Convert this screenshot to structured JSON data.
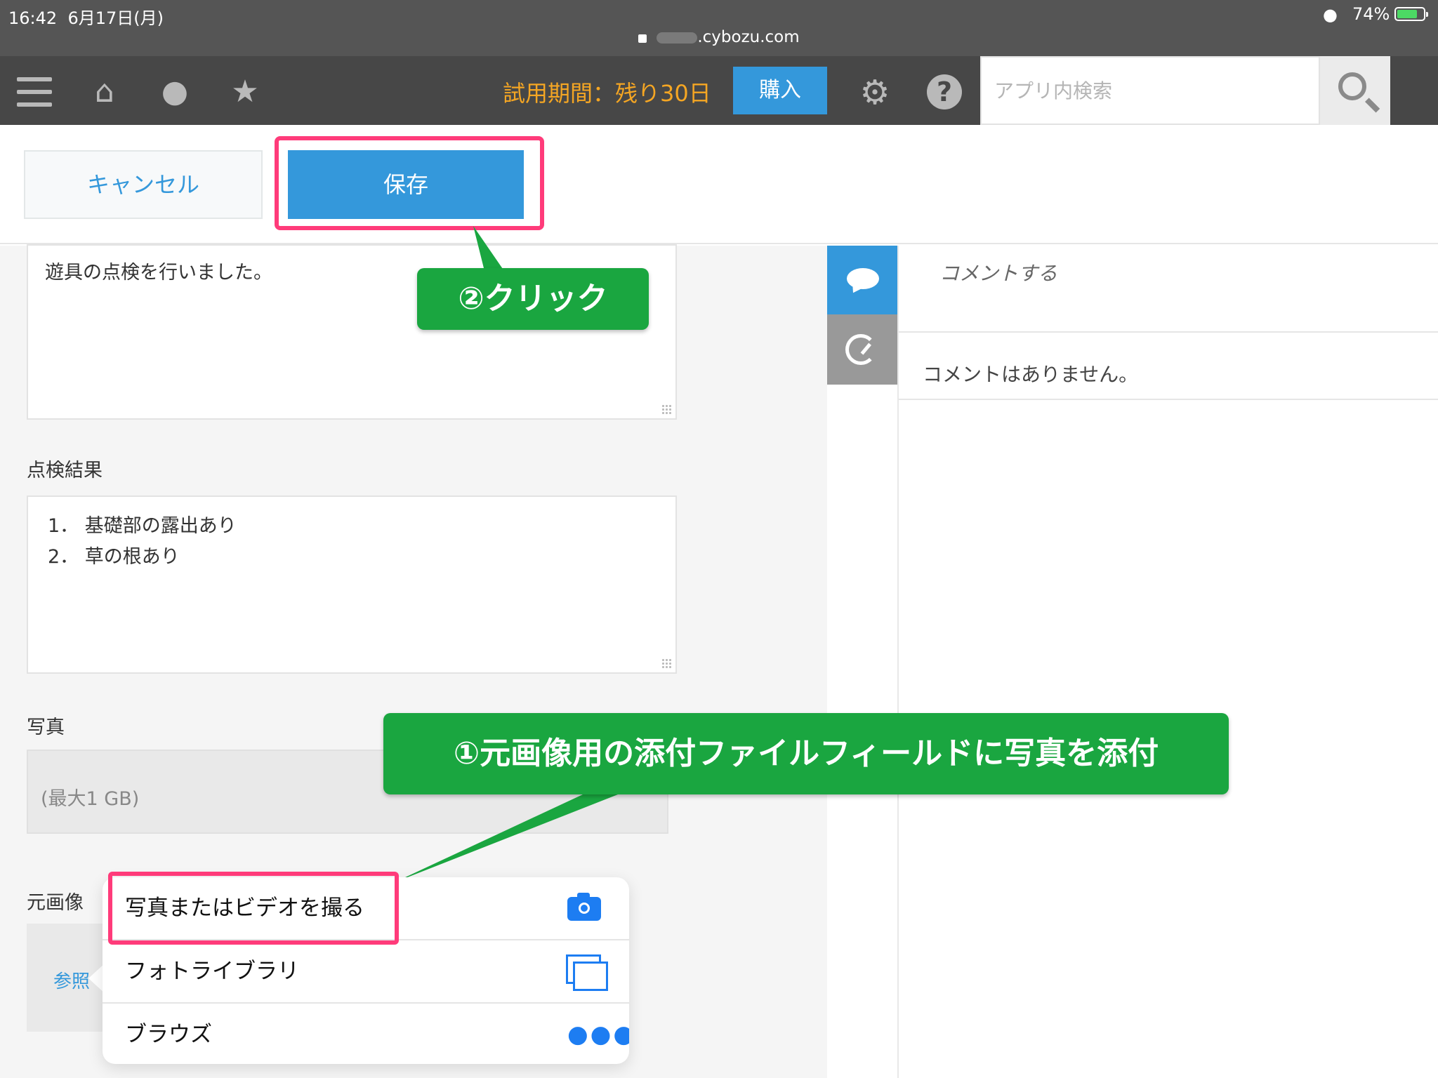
{
  "status_bar": {
    "time": "16:42",
    "date": "6月17日(月)",
    "battery": "74%",
    "url": ".cybozu.com"
  },
  "header": {
    "trial_text": "試用期間：残り30日",
    "buy_label": "購入",
    "search_placeholder": "アプリ内検索"
  },
  "toolbar": {
    "cancel_label": "キャンセル",
    "save_label": "保存"
  },
  "form": {
    "description_value": "遊具の点検を行いました。",
    "result_label": "点検結果",
    "result_lines": [
      "1． 基礎部の露出あり",
      "2． 草の根あり"
    ],
    "photo_label": "写真",
    "photo_max_size": "(最大1 GB)",
    "original_label": "元画像",
    "browse_label": "参照"
  },
  "comments": {
    "input_placeholder": "コメントする",
    "empty_text": "コメントはありません。"
  },
  "callouts": {
    "click": "②クリック",
    "attach": "①元画像用の添付ファイルフィールドに写真を添付"
  },
  "popover": {
    "items": [
      {
        "label": "写真またはビデオを撮る",
        "icon": "camera-icon"
      },
      {
        "label": "フォトライブラリ",
        "icon": "photo-library-icon"
      },
      {
        "label": "ブラウズ",
        "icon": "more-icon"
      }
    ]
  },
  "colors": {
    "accent_blue": "#3498db",
    "header_bg": "#474747",
    "trial_orange": "#f5a623",
    "callout_green": "#1aa640",
    "highlight_pink": "#ff3b7a",
    "ios_blue": "#1d7df2"
  }
}
